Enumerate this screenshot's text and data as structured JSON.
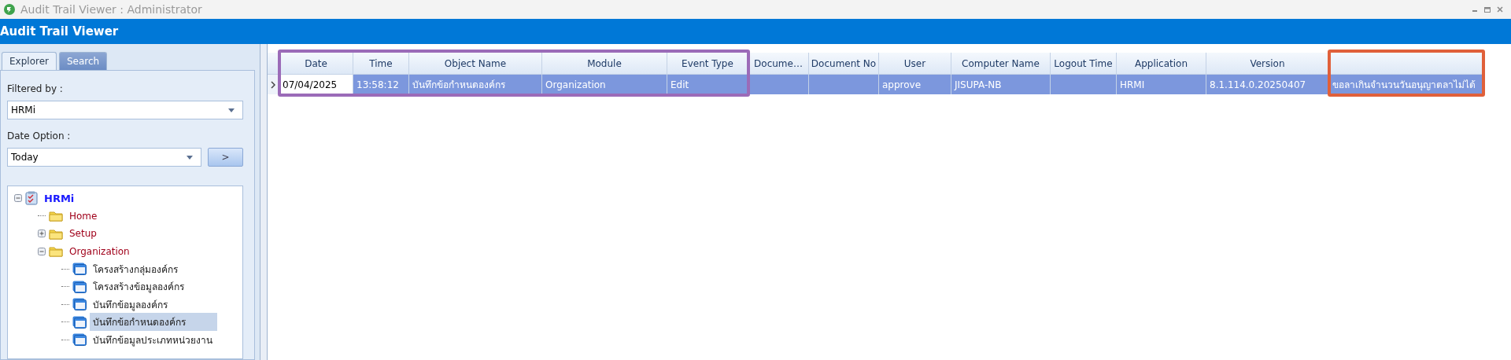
{
  "window": {
    "title": "Audit Trail Viewer : Administrator"
  },
  "header": {
    "title": "Audit Trail Viewer"
  },
  "sidebar": {
    "tabs": [
      {
        "label": "Explorer",
        "selected": true
      },
      {
        "label": "Search",
        "selected": false
      }
    ],
    "filter_label": "Filtered by :",
    "filter_value": "HRMi",
    "date_label": "Date Option :",
    "date_value": "Today",
    "go_button": ">",
    "tree": [
      {
        "label": "HRMi",
        "kind": "root",
        "expanded": true,
        "selected": false,
        "children": [
          {
            "label": "Home",
            "kind": "folder",
            "selected": false
          },
          {
            "label": "Setup",
            "kind": "folder",
            "expanded": false,
            "selected": false
          },
          {
            "label": "Organization",
            "kind": "folder",
            "expanded": true,
            "selected": false,
            "children": [
              {
                "label": "โครงสร้างกลุ่มองค์กร",
                "kind": "form",
                "selected": false
              },
              {
                "label": "โครงสร้างข้อมูลองค์กร",
                "kind": "form",
                "selected": false
              },
              {
                "label": "บันทึกข้อมูลองค์กร",
                "kind": "form",
                "selected": false
              },
              {
                "label": "บันทึกข้อกำหนดองค์กร",
                "kind": "form",
                "selected": true
              },
              {
                "label": "บันทึกข้อมูลประเภทหน่วยงาน",
                "kind": "form",
                "selected": false
              }
            ]
          }
        ]
      }
    ]
  },
  "table": {
    "columns": [
      {
        "label": "Date",
        "color": "#9b6bb8"
      },
      {
        "label": "Time",
        "color": "#9b6bb8"
      },
      {
        "label": "Object Name",
        "color": "#9b6bb8"
      },
      {
        "label": "Module",
        "color": "#9b6bb8"
      },
      {
        "label": "Event Type",
        "color": "#9b6bb8"
      },
      {
        "label": "Docume…"
      },
      {
        "label": "Document No"
      },
      {
        "label": "User"
      },
      {
        "label": "Computer Name"
      },
      {
        "label": "Logout Time"
      },
      {
        "label": "Application"
      },
      {
        "label": "Version"
      },
      {
        "color": "#e0603a"
      }
    ],
    "rows": [
      {
        "selected": true,
        "cells": [
          {
            "text": "07/04/2025",
            "focused": true
          },
          {
            "text": "13:58:12",
            "focused": false
          },
          {
            "text": "บันทึกข้อกำหนดองค์กร",
            "focused": false
          },
          {
            "text": "Organization",
            "focused": false
          },
          {
            "text": "Edit",
            "focused": false
          },
          {
            "text": "",
            "focused": false
          },
          {
            "text": "",
            "focused": false
          },
          {
            "text": "approve",
            "focused": false
          },
          {
            "text": "JISUPA-NB",
            "focused": false
          },
          {
            "text": "",
            "focused": false
          },
          {
            "text": "HRMI",
            "focused": false
          },
          {
            "text": "8.1.114.0.20250407",
            "focused": false
          },
          {
            "text": "ขอลาเกินจำนวนวันอนุญาตลาไม่ได้",
            "focused": false
          }
        ]
      }
    ]
  }
}
